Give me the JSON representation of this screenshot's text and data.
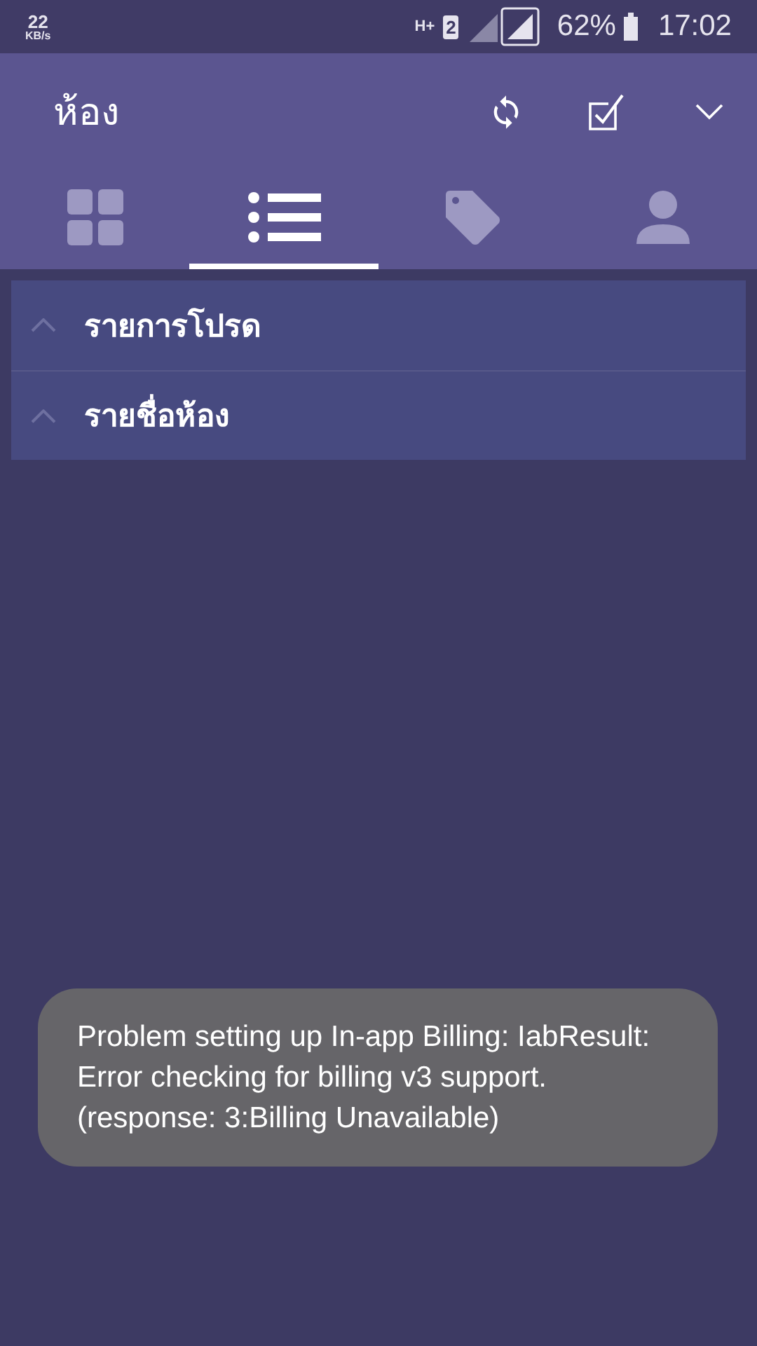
{
  "status_bar": {
    "speed": "22",
    "speed_unit": "KB/s",
    "network": "H+",
    "sim": "2",
    "battery": "62%",
    "time": "17:02"
  },
  "app_bar": {
    "title": "ห้อง"
  },
  "tabs": [
    {
      "kind": "grid",
      "selected": false
    },
    {
      "kind": "list",
      "selected": true
    },
    {
      "kind": "tag",
      "selected": false
    },
    {
      "kind": "person",
      "selected": false
    }
  ],
  "groups": [
    {
      "label": "รายการโปรด"
    },
    {
      "label": "รายชื่อห้อง"
    }
  ],
  "toast": {
    "message": "Problem setting up In-app Billing: IabResult: Error checking for billing v3 support. (response: 3:Billing Unavailable)"
  }
}
